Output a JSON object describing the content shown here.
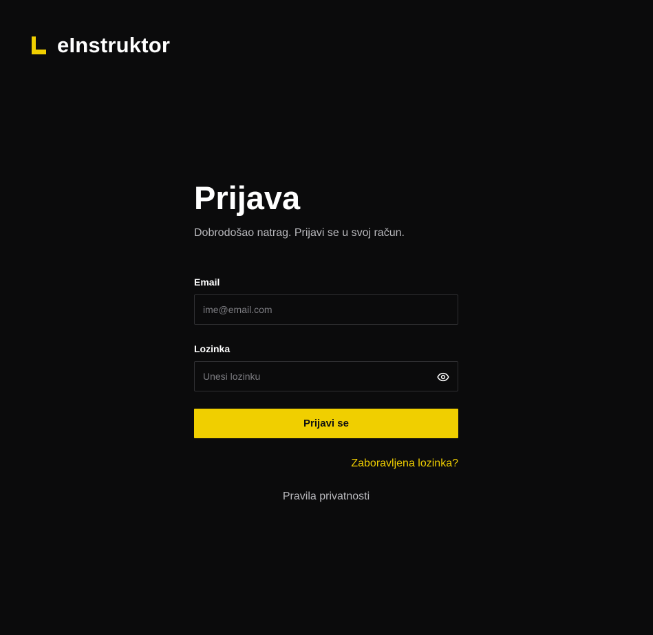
{
  "brand": {
    "name": "eInstruktor",
    "accent_color": "#f0cf00"
  },
  "login": {
    "title": "Prijava",
    "subtitle": "Dobrodošao natrag. Prijavi se u svoj račun.",
    "email": {
      "label": "Email",
      "placeholder": "ime@email.com",
      "value": ""
    },
    "password": {
      "label": "Lozinka",
      "placeholder": "Unesi lozinku",
      "value": "",
      "toggle_icon": "eye-icon"
    },
    "submit_label": "Prijavi se",
    "forgot_label": "Zaboravljena lozinka?",
    "privacy_label": "Pravila privatnosti"
  },
  "colors": {
    "background": "#0b0b0c",
    "accent": "#f0cf00",
    "muted_text": "#b9b9bd",
    "input_border": "#303033"
  }
}
